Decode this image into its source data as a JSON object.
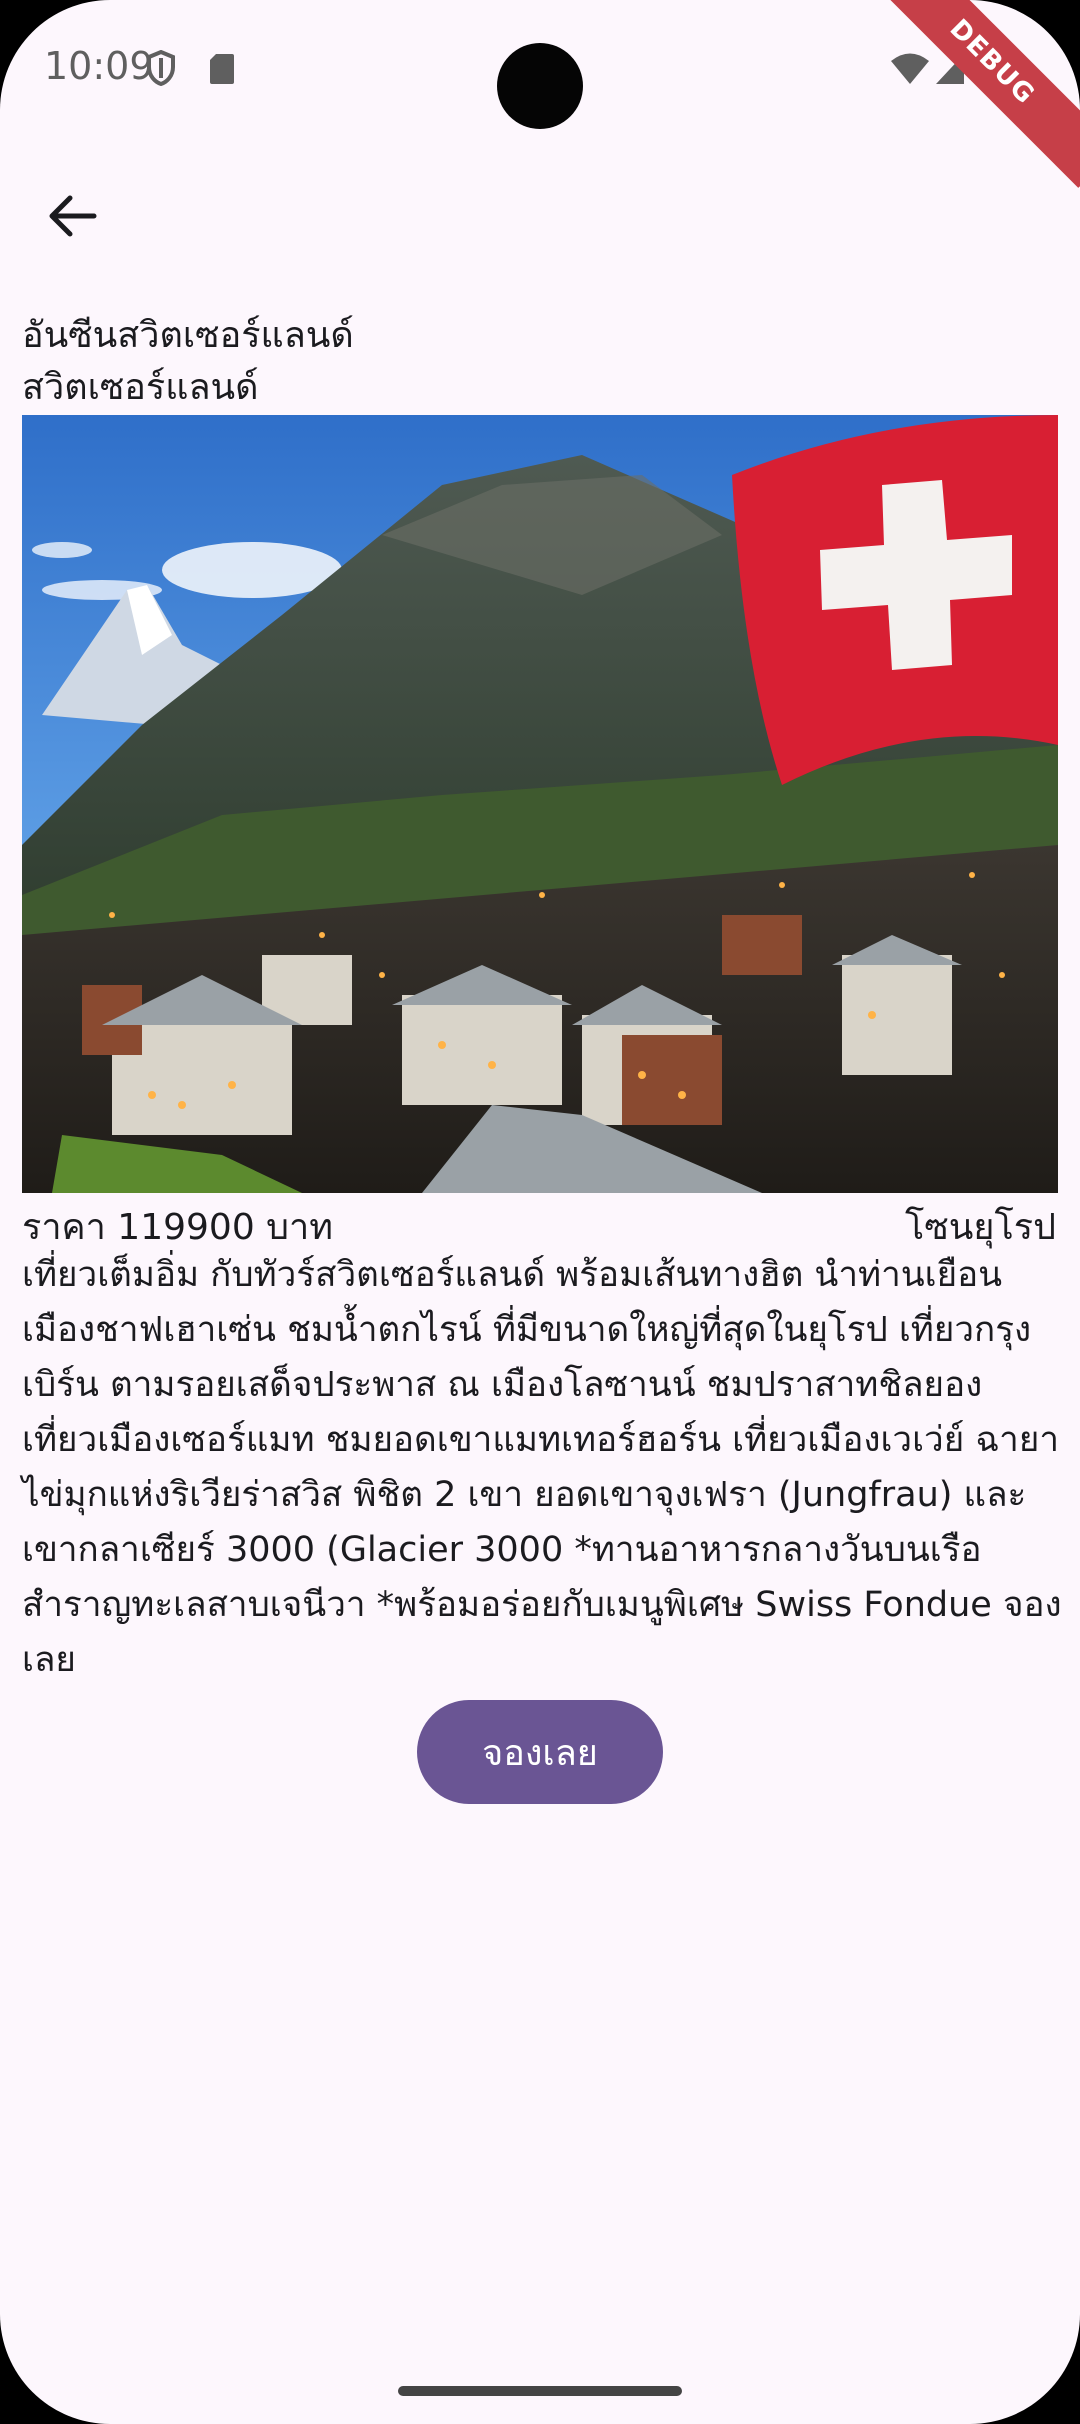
{
  "status_bar": {
    "time": "10:09",
    "debug_label": "DEBUG"
  },
  "header": {
    "back_icon": "arrow-left-icon"
  },
  "tour": {
    "title": "อันซีนสวิตเซอร์แลนด์",
    "country": "สวิตเซอร์แลนด์",
    "price_text": "ราคา 119900 บาท",
    "zone": "โซนยุโรป",
    "description": "เที่ยวเต็มอิ่ม กับทัวร์สวิตเซอร์แลนด์ พร้อมเส้นทางฮิต นำท่านเยือนเมืองชาฟเฮาเซ่น ชมน้ำตกไรน์ ที่มีขนาดใหญ่ที่สุดในยุโรป เที่ยวกรุงเบิร์น ตามรอยเสด็จประพาส ณ เมืองโลซานน์ ชมปราสาทชิลยอง เที่ยวเมืองเซอร์แมท ชมยอดเขาแมทเทอร์ฮอร์น เที่ยวเมืองเวเว่ย์ ฉายา ไข่มุกแห่งริเวียร่าสวิส พิชิต 2 เขา ยอดเขาจุงเฟรา (Jungfrau) และ เขากลาเซียร์ 3000 (Glacier 3000 *ทานอาหารกลางวันบนเรือสำราญทะเลสาบเจนีวา *พร้อมอร่อยกับเมนูพิเศษ Swiss Fondue จองเลย",
    "book_label": "จองเลย"
  },
  "colors": {
    "background": "#fdf7fd",
    "button": "#6a5594",
    "debug_ribbon": "#c63f48"
  }
}
